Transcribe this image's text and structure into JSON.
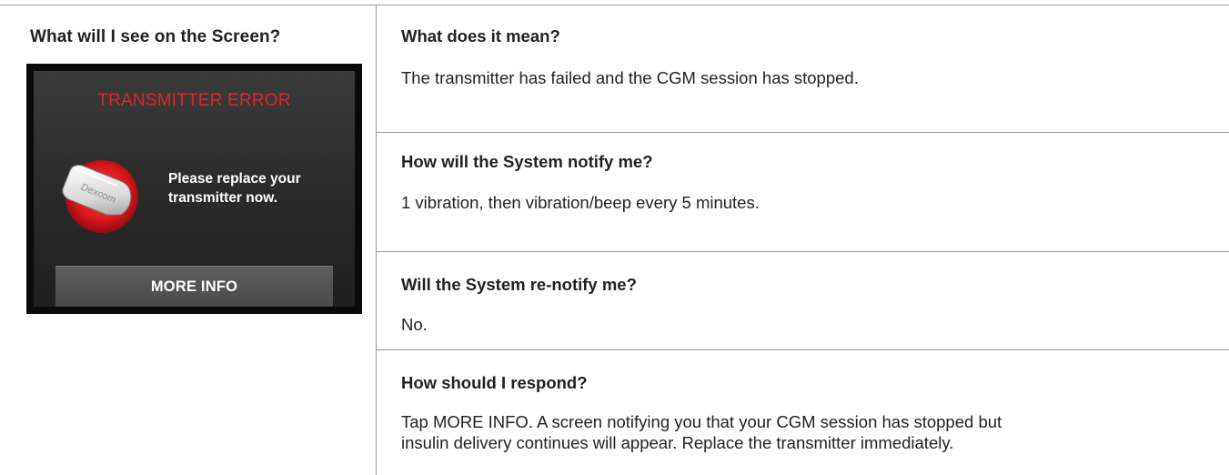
{
  "left": {
    "heading": "What will I see on the Screen?"
  },
  "device_screen": {
    "title": "TRANSMITTER ERROR",
    "title_color": "#e0262b",
    "logo_text": "Dexcom",
    "message_line1": "Please replace your",
    "message_line2": "transmitter now.",
    "button_label": "MORE INFO",
    "icon": "transmitter-icon"
  },
  "sections": [
    {
      "heading": "What does it mean?",
      "body": "The transmitter has failed and the CGM session has stopped."
    },
    {
      "heading": "How will the System notify me?",
      "body": "1 vibration, then vibration/beep every 5 minutes."
    },
    {
      "heading": "Will the System re-notify me?",
      "body": "No."
    },
    {
      "heading": "How should I respond?",
      "body_lead": "Tap ",
      "body_ref": "MORE INFO",
      "body_line1_rest": ". A screen notifying you that your CGM session has stopped but",
      "body_line2": "insulin delivery continues will appear. Replace the transmitter immediately."
    }
  ]
}
